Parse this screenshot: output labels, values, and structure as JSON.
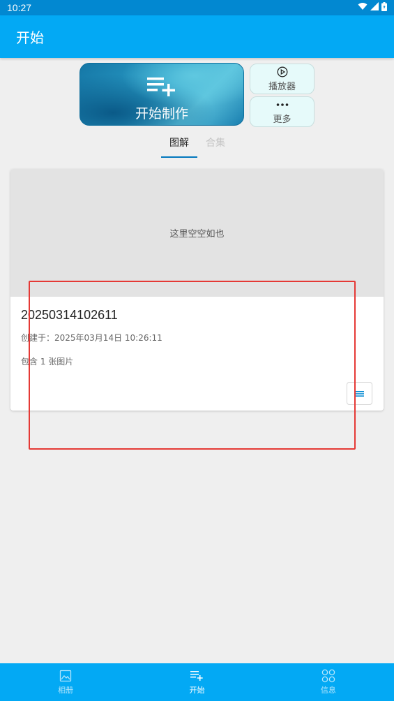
{
  "status_bar": {
    "time": "10:27"
  },
  "app_bar": {
    "title": "开始"
  },
  "actions": {
    "make_label": "开始制作",
    "player_label": "播放器",
    "more_label": "更多"
  },
  "tabs": [
    {
      "label": "图解",
      "active": true
    },
    {
      "label": "合集",
      "active": false
    }
  ],
  "card": {
    "empty_text": "这里空空如也",
    "title": "20250314102611",
    "created": "创建于：2025年03月14日 10:26:11",
    "count": "包含 1 张图片"
  },
  "bottom_nav": [
    {
      "label": "相册",
      "icon": "image-icon",
      "active": false
    },
    {
      "label": "开始",
      "icon": "playlist-add-icon",
      "active": true
    },
    {
      "label": "信息",
      "icon": "apps-icon",
      "active": false
    }
  ],
  "colors": {
    "primary": "#03a9f4",
    "status_bar": "#0288d1",
    "highlight": "#e53935"
  }
}
